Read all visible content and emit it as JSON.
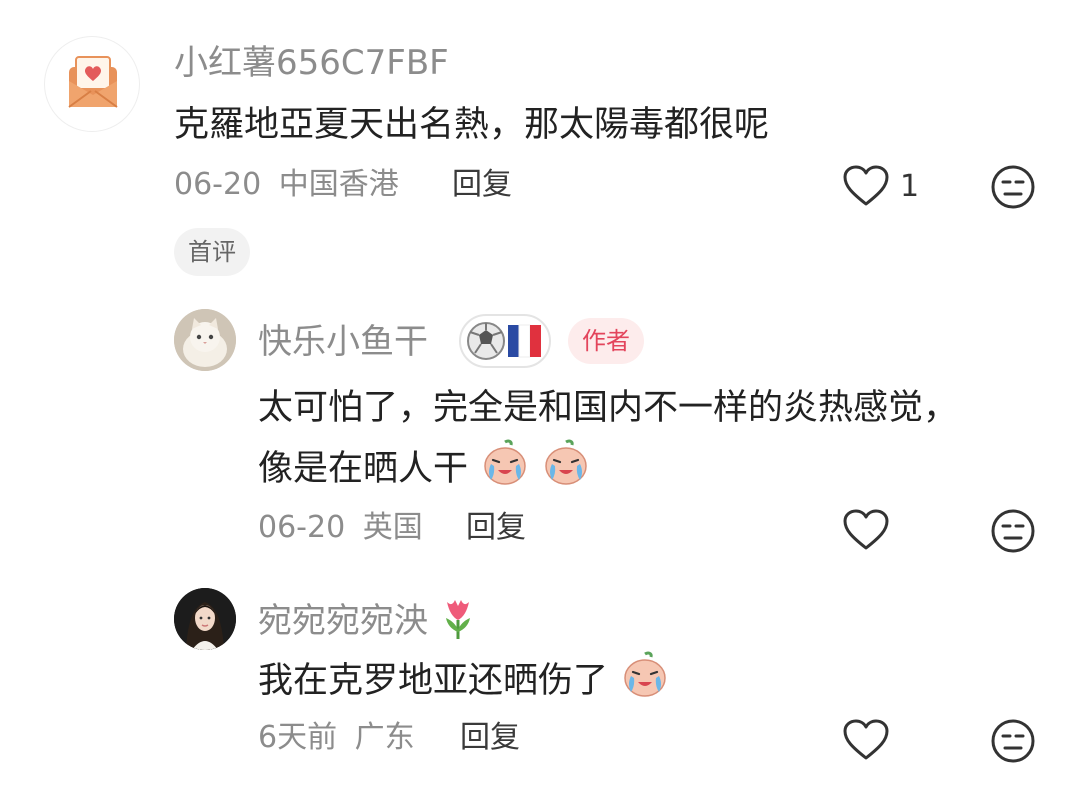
{
  "comments": [
    {
      "username": "小红薯656C7FBF",
      "text": "克羅地亞夏天出名熱，那太陽毒都很呢",
      "date": "06-20",
      "location": "中国香港",
      "reply_label": "回复",
      "like_count": "1",
      "tag": "首评",
      "avatar_icon": "envelope-heart-icon"
    },
    {
      "username": "快乐小鱼干",
      "badge_icon": "football-france-flag-icon",
      "author_tag": "作者",
      "text_line1": "太可怕了，完全是和国内不一样的炎热感觉，",
      "text_line2": "像是在晒人干",
      "date": "06-20",
      "location": "英国",
      "reply_label": "回复",
      "avatar_icon": "cat-avatar"
    },
    {
      "username": "宛宛宛宛泱",
      "name_emoji": "tulip-icon",
      "text": "我在克罗地亚还晒伤了",
      "date": "6天前",
      "location": "广东",
      "reply_label": "回复",
      "avatar_icon": "woman-avatar"
    }
  ],
  "colors": {
    "username": "#8c8c8c",
    "text": "#222222",
    "author_tag_bg": "#fdecec",
    "author_tag_text": "#e3455c",
    "tag_bg": "#f2f2f2"
  }
}
